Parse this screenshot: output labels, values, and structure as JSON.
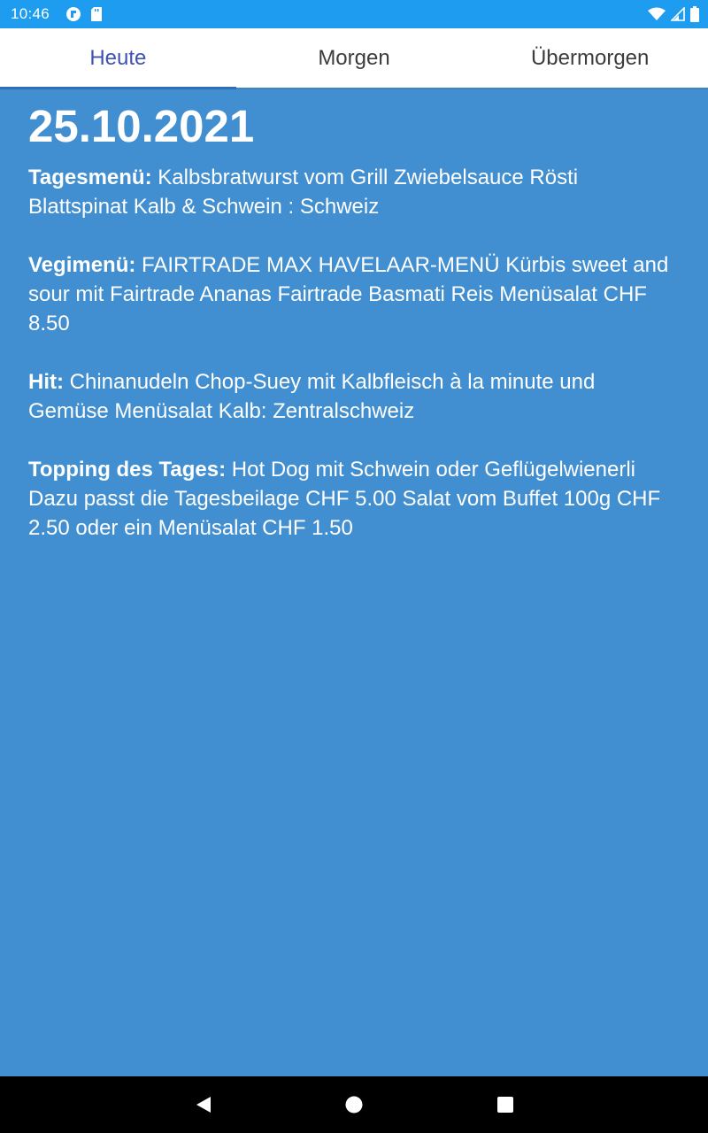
{
  "status_bar": {
    "time": "10:46",
    "icons_left": [
      "app-notification-icon",
      "sd-card-icon"
    ],
    "icons_right": [
      "wifi-icon",
      "cell-signal-icon",
      "battery-icon"
    ]
  },
  "tabs": [
    {
      "label": "Heute",
      "active": true
    },
    {
      "label": "Morgen",
      "active": false
    },
    {
      "label": "Übermorgen",
      "active": false
    }
  ],
  "day": {
    "date": "25.10.2021",
    "menus": [
      {
        "label": "Tagesmenü:",
        "text": "Kalbsbratwurst vom Grill Zwiebelsauce Rösti Blattspinat Kalb & Schwein : Schweiz"
      },
      {
        "label": "Vegimenü:",
        "text": "FAIRTRADE MAX HAVELAAR-MENÜ Kürbis sweet and sour mit Fairtrade Ananas Fairtrade Basmati Reis Menüsalat CHF 8.50"
      },
      {
        "label": "Hit:",
        "text": "Chinanudeln Chop-Suey mit Kalbfleisch à la minute und Gemüse Menüsalat Kalb: Zentralschweiz"
      },
      {
        "label": "Topping des Tages:",
        "text": "Hot Dog mit Schwein oder Geflügelwienerli Dazu passt die Tagesbeilage CHF 5.00 Salat vom Buffet 100g CHF 2.50 oder ein Menüsalat CHF 1.50"
      }
    ]
  },
  "nav_bar": {
    "buttons": [
      "back-icon",
      "home-icon",
      "recents-icon"
    ]
  },
  "colors": {
    "status_bar": "#1e9cf0",
    "background": "#418fd0",
    "tab_active": "#3f51b5",
    "tab_inactive": "#3c3c3c"
  }
}
